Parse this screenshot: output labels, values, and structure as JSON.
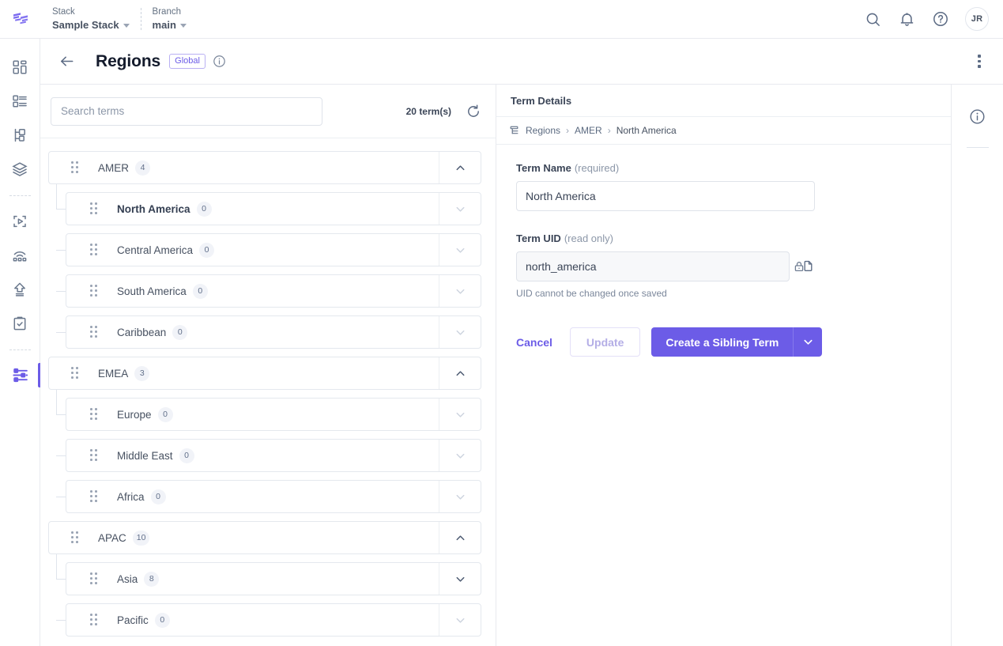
{
  "topbar": {
    "logo_name": "contentstack-logo",
    "stack": {
      "label": "Stack",
      "value": "Sample Stack"
    },
    "branch": {
      "label": "Branch",
      "value": "main"
    },
    "icons": [
      "search-icon",
      "notifications-bell-icon",
      "help-circle-icon"
    ],
    "avatar_initials": "JR"
  },
  "rail": {
    "items": [
      {
        "name": "dashboard-icon"
      },
      {
        "name": "content-types-icon"
      },
      {
        "name": "hierarchy-icon"
      },
      {
        "name": "stacks-layers-icon"
      },
      {
        "name": "assets-play-icon"
      },
      {
        "name": "releases-icon"
      },
      {
        "name": "publish-upload-icon"
      },
      {
        "name": "tasks-clipboard-icon"
      },
      {
        "name": "settings-sliders-icon"
      }
    ]
  },
  "header": {
    "back_label": "back-arrow-icon",
    "title": "Regions",
    "scope_badge": "Global",
    "info_icon": "info-circle-icon",
    "menu_icon": "kebab-menu-icon"
  },
  "tree": {
    "search_placeholder": "Search terms",
    "search_value": "",
    "count_number": "20",
    "count_suffix": "term(s)",
    "refresh_icon": "refresh-icon",
    "groups": [
      {
        "label": "AMER",
        "count": "4",
        "expanded": true,
        "children": [
          {
            "label": "North America",
            "count": "0",
            "selected": true
          },
          {
            "label": "Central America",
            "count": "0",
            "selected": false
          },
          {
            "label": "South America",
            "count": "0",
            "selected": false
          },
          {
            "label": "Caribbean",
            "count": "0",
            "selected": false
          }
        ]
      },
      {
        "label": "EMEA",
        "count": "3",
        "expanded": true,
        "children": [
          {
            "label": "Europe",
            "count": "0",
            "selected": false
          },
          {
            "label": "Middle East",
            "count": "0",
            "selected": false
          },
          {
            "label": "Africa",
            "count": "0",
            "selected": false
          }
        ]
      },
      {
        "label": "APAC",
        "count": "10",
        "expanded": true,
        "children": [
          {
            "label": "Asia",
            "count": "8",
            "selected": false,
            "has_children": true
          },
          {
            "label": "Pacific",
            "count": "0",
            "selected": false
          }
        ]
      }
    ]
  },
  "details": {
    "panel_title": "Term Details",
    "breadcrumb": {
      "icon": "taxonomy-icon",
      "items": [
        "Regions",
        "AMER",
        "North America"
      ],
      "separator": "›"
    },
    "term_name": {
      "label": "Term Name",
      "hint": "(required)",
      "value": "North America"
    },
    "term_uid": {
      "label": "Term UID",
      "hint": "(read only)",
      "value": "north_america",
      "lock_icon": "lock-icon",
      "copy_icon": "copy-icon",
      "help": "UID cannot be changed once saved"
    },
    "actions": {
      "cancel": "Cancel",
      "update": "Update",
      "create_sibling": "Create a Sibling Term",
      "split_icon": "chevron-down-icon"
    }
  },
  "right_rail": {
    "info_icon": "info-circle-icon"
  },
  "colors": {
    "accent": "#6c5ce7",
    "text": "#475161",
    "heading": "#141b2c",
    "border": "#e4e8ee",
    "muted": "#8c97a8"
  }
}
